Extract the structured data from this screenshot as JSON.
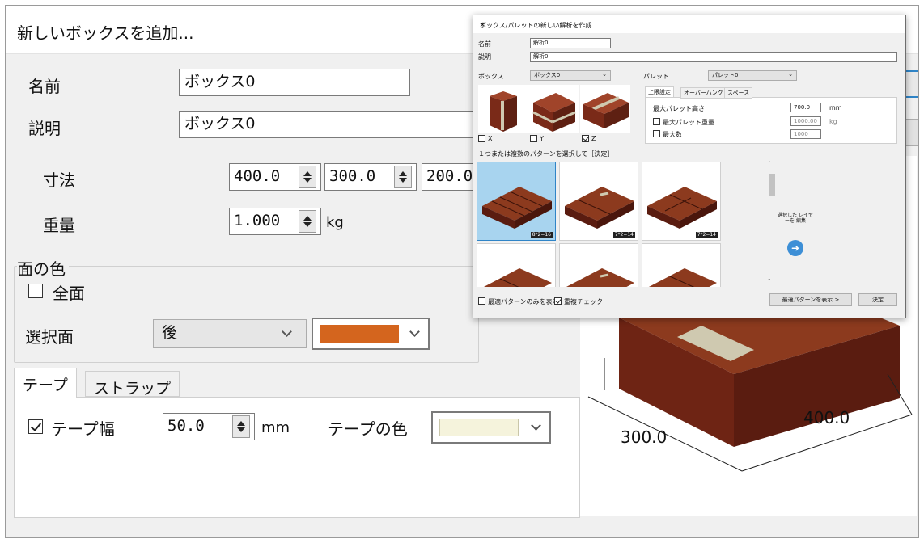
{
  "back_dialog": {
    "title": "新しいボックスを追加...",
    "name_label": "名前",
    "name_value": "ボックス0",
    "desc_label": "説明",
    "desc_value": "ボックス0",
    "dim_label": "寸法",
    "dim_values": [
      "400.0",
      "300.0",
      "200.0"
    ],
    "weight_label": "重量",
    "weight_value": "1.000",
    "weight_unit": "kg",
    "face_group_label": "面の色",
    "all_faces_label": "全面",
    "selected_face_label": "選択面",
    "selected_face_value": "後",
    "face_color": "#d4651e",
    "tabs": [
      "テープ",
      "ストラップ"
    ],
    "tape_width_label": "テープ幅",
    "tape_width_value": "50.0",
    "tape_width_unit": "mm",
    "tape_color_label": "テープの色",
    "tape_color": "#f5f3dc",
    "preview_dim_a": "400.0",
    "preview_dim_b": "300.0"
  },
  "front_dialog": {
    "title": "ボックス/パレットの新しい解析を作成...",
    "name_label": "名前",
    "name_value": "解析0",
    "desc_label": "説明",
    "desc_value": "解析0",
    "box_label": "ボックス",
    "box_value": "ボックス0",
    "pallet_label": "パレット",
    "pallet_value": "パレット0",
    "orient_labels": [
      "X",
      "Y",
      "Z"
    ],
    "tabs": [
      "上限設定",
      "オーバーハング",
      "スペース"
    ],
    "max_height_label": "最大パレット高さ",
    "max_height_value": "700.0",
    "max_height_unit": "mm",
    "max_weight_label": "最大パレット重量",
    "max_weight_value": "1000.00",
    "max_weight_unit": "kg",
    "max_count_label": "最大数",
    "max_count_value": "1000",
    "pattern_prompt": "１つまたは複数のパターンを選択して［決定］",
    "tile_labels": [
      "8*2=16",
      "7*2=14",
      "7*2=14"
    ],
    "edit_layer_button": "選択した レイヤーを 編集",
    "best_only_label": "最適パターンのみを表示",
    "overlap_check_label": "重複チェック",
    "show_best_button": "最適パターンを表示 >",
    "ok_button": "決定"
  }
}
